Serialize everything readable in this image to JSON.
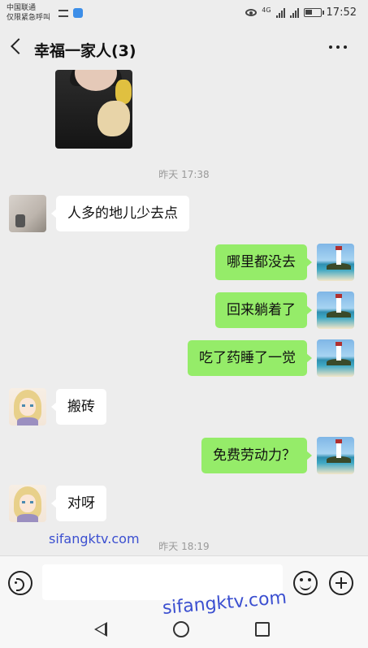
{
  "status_bar": {
    "carrier_line1": "中国联通",
    "carrier_line2": "仅限紧急呼叫",
    "network": "4G",
    "time": "17:52"
  },
  "header": {
    "title": "幸福一家人(3)"
  },
  "messages": [
    {
      "type": "image",
      "side": "left"
    },
    {
      "type": "timestamp",
      "text": "昨天 17:38"
    },
    {
      "type": "text",
      "side": "left",
      "avatar": "room",
      "text": "人多的地儿少去点"
    },
    {
      "type": "text",
      "side": "right",
      "avatar": "lighthouse",
      "text": "哪里都没去"
    },
    {
      "type": "text",
      "side": "right",
      "avatar": "lighthouse",
      "text": "回来躺着了"
    },
    {
      "type": "text",
      "side": "right",
      "avatar": "lighthouse",
      "text": "吃了药睡了一觉"
    },
    {
      "type": "text",
      "side": "left",
      "avatar": "anime-girl",
      "text": "搬砖"
    },
    {
      "type": "text",
      "side": "right",
      "avatar": "lighthouse",
      "text": "免费劳动力？"
    },
    {
      "type": "text",
      "side": "left",
      "avatar": "anime-girl",
      "text": "对呀"
    },
    {
      "type": "timestamp",
      "text": "昨天 18:19"
    }
  ],
  "watermarks": [
    "sifangktv.com",
    "sifangktv.com"
  ],
  "input": {
    "value": ""
  },
  "icons": [
    "back-arrow-icon",
    "more-icon",
    "voice-icon",
    "emoji-icon",
    "plus-icon",
    "nav-back-icon",
    "nav-home-icon",
    "nav-recent-icon"
  ],
  "colors": {
    "background": "#ededed",
    "sent_bubble": "#95ec69",
    "received_bubble": "#ffffff",
    "watermark": "#3b4fd0"
  }
}
